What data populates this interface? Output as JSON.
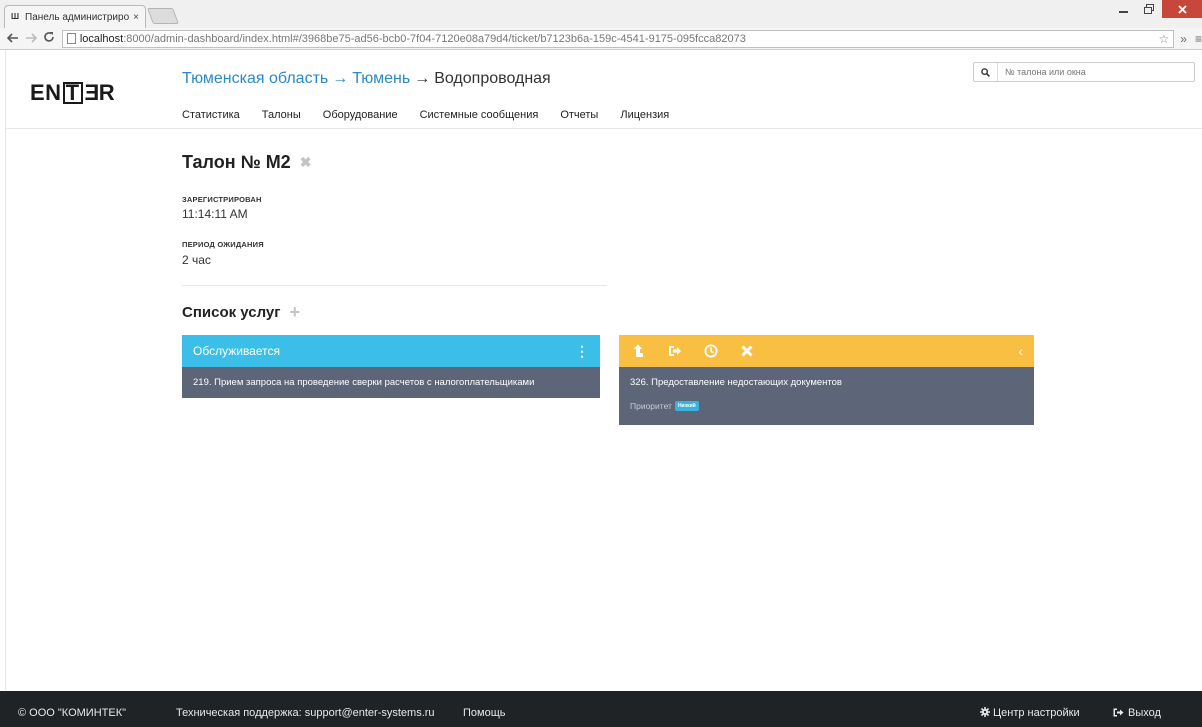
{
  "browser": {
    "tab_title": "Панель администрирова",
    "tab_close": "×",
    "address_host": "localhost",
    "address_path": ":8000/admin-dashboard/index.html#/3968be75-ad56-bcb0-7f04-7120e08a79d4/ticket/b7123b6a-159c-4541-9175-095fcca82073"
  },
  "header": {
    "logo": {
      "left": "EN",
      "box": "T",
      "mid": "E",
      "right": "R"
    },
    "breadcrumb": {
      "region": "Тюменская область",
      "city": "Тюмень",
      "current": "Водопроводная",
      "separator": "→"
    },
    "nav": [
      "Статистика",
      "Талоны",
      "Оборудование",
      "Системные сообщения",
      "Отчеты",
      "Лицензия"
    ],
    "search_placeholder": "№ талона или окна"
  },
  "ticket": {
    "title": "Талон № M2",
    "registered_label": "ЗАРЕГИСТРИРОВАН",
    "registered_value": "11:14:11 AM",
    "wait_label": "ПЕРИОД ОЖИДАНИЯ",
    "wait_value": "2 час"
  },
  "services": {
    "title": "Список услуг",
    "serving": {
      "header": "Обслуживается",
      "item": "219. Прием запроса на проведение сверки расчетов с налогоплательщиками"
    },
    "queued": {
      "item": "326. Предоставление недостающих документов",
      "priority_label": "Приоритет",
      "priority_value": "Низкий"
    }
  },
  "footer": {
    "copyright": "© ООО \"КОМИНТЕК\"",
    "support": "Техническая поддержка: support@enter-systems.ru",
    "help": "Помощь",
    "settings": "Центр настройки",
    "logout": "Выход"
  },
  "colors": {
    "accent_blue": "#3bbfe9",
    "accent_orange": "#f9bf43",
    "card_body": "#5d6579",
    "link": "#2a8ac6",
    "footer_bg": "#1f2326"
  }
}
